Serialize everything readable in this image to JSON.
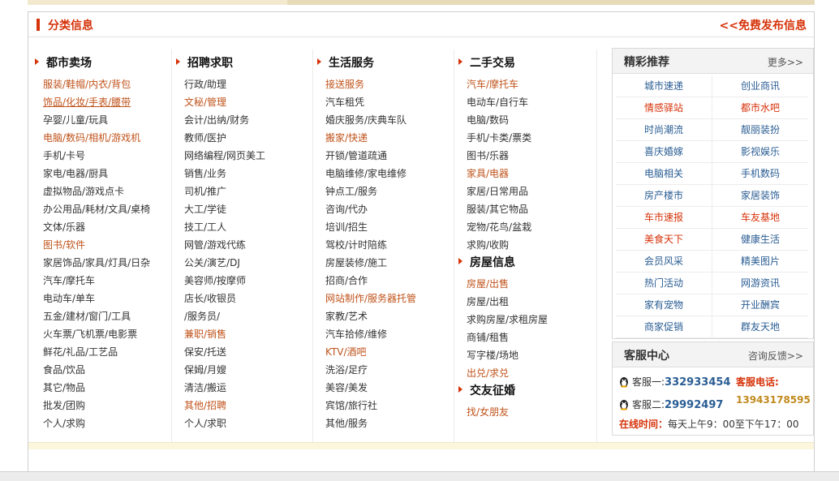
{
  "header": {
    "title": "分类信息",
    "post_link": "<<免费发布信息"
  },
  "columns": [
    {
      "sections": [
        {
          "name": "都市卖场",
          "items": [
            {
              "t": "服装/鞋帽/内衣/背包",
              "hot": true
            },
            {
              "t": "饰品/化妆/手表/腰带",
              "hot": true,
              "ul": true
            },
            {
              "t": "孕婴/儿童/玩具"
            },
            {
              "t": "电脑/数码/相机/游戏机",
              "hot": true
            },
            {
              "t": "手机/卡号"
            },
            {
              "t": "家电/电器/厨具"
            },
            {
              "t": "虚拟物品/游戏点卡"
            },
            {
              "t": "办公用品/耗材/文具/桌椅"
            },
            {
              "t": "文体/乐器"
            },
            {
              "t": "图书/软件",
              "hot": true
            },
            {
              "t": "家居饰品/家具/灯具/日杂"
            },
            {
              "t": "汽车/摩托车"
            },
            {
              "t": "电动车/单车"
            },
            {
              "t": "五金/建材/窗门/工具"
            },
            {
              "t": "火车票/飞机票/电影票"
            },
            {
              "t": "鲜花/礼品/工艺品"
            },
            {
              "t": "食品/饮品"
            },
            {
              "t": "其它/物品"
            },
            {
              "t": "批发/团购"
            },
            {
              "t": "个人/求购"
            }
          ]
        }
      ]
    },
    {
      "sections": [
        {
          "name": "招聘求职",
          "items": [
            {
              "t": "行政/助理"
            },
            {
              "t": "文秘/管理",
              "hot": true
            },
            {
              "t": "会计/出纳/财务"
            },
            {
              "t": "教师/医护"
            },
            {
              "t": "网络编程/网页美工"
            },
            {
              "t": "销售/业务"
            },
            {
              "t": "司机/推广"
            },
            {
              "t": "大工/学徒"
            },
            {
              "t": "技工/工人"
            },
            {
              "t": "网管/游戏代练"
            },
            {
              "t": "公关/演艺/DJ"
            },
            {
              "t": "美容师/按摩师"
            },
            {
              "t": "店长/收银员"
            },
            {
              "t": "/服务员/"
            },
            {
              "t": "兼职/销售",
              "hot": true
            },
            {
              "t": "保安/托送"
            },
            {
              "t": "保姆/月嫂"
            },
            {
              "t": "清洁/搬运"
            },
            {
              "t": "其他/招聘",
              "hot": true
            },
            {
              "t": "个人/求职"
            }
          ]
        }
      ]
    },
    {
      "sections": [
        {
          "name": "生活服务",
          "items": [
            {
              "t": "接送服务",
              "hot": true
            },
            {
              "t": "汽车租凭"
            },
            {
              "t": "婚庆服务/庆典车队"
            },
            {
              "t": "搬家/快递",
              "hot": true
            },
            {
              "t": "开锁/管道疏通"
            },
            {
              "t": "电脑维修/家电维修"
            },
            {
              "t": "钟点工/服务"
            },
            {
              "t": "咨询/代办"
            },
            {
              "t": "培训/招生"
            },
            {
              "t": "驾校/计时陪练"
            },
            {
              "t": "房屋装修/施工"
            },
            {
              "t": "招商/合作"
            },
            {
              "t": "网站制作/服务器托管",
              "hot": true
            },
            {
              "t": "家教/艺术"
            },
            {
              "t": "汽车拾修/维修"
            },
            {
              "t": "KTV/酒吧",
              "hot": true
            },
            {
              "t": "洗浴/足疗"
            },
            {
              "t": "美容/美发"
            },
            {
              "t": "宾馆/旅行社"
            },
            {
              "t": "其他/服务"
            }
          ]
        }
      ]
    },
    {
      "sections": [
        {
          "name": "二手交易",
          "items": [
            {
              "t": "汽车/摩托车",
              "hot": true
            },
            {
              "t": "电动车/自行车"
            },
            {
              "t": "电脑/数码"
            },
            {
              "t": "手机/卡类/票类"
            },
            {
              "t": "图书/乐器"
            },
            {
              "t": "家具/电器",
              "hot": true
            },
            {
              "t": "家居/日常用品"
            },
            {
              "t": "服装/其它物品"
            },
            {
              "t": "宠物/花鸟/盆栽"
            },
            {
              "t": "求购/收购"
            }
          ]
        },
        {
          "name": "房屋信息",
          "items": [
            {
              "t": "房屋/出售",
              "hot": true
            },
            {
              "t": "房屋/出租"
            },
            {
              "t": "求购房屋/求租房屋"
            },
            {
              "t": "商铺/租售"
            },
            {
              "t": "写字楼/场地"
            },
            {
              "t": "出兑/求兑",
              "hot": true
            }
          ]
        },
        {
          "name": "交友征婚",
          "items": [
            {
              "t": "找/女朋友",
              "hot": true
            }
          ]
        }
      ]
    }
  ],
  "featured": {
    "title": "精彩推荐",
    "more": "更多>>",
    "links": [
      {
        "t": "城市速递"
      },
      {
        "t": "创业商讯"
      },
      {
        "t": "情感驿站",
        "hot": true
      },
      {
        "t": "都市水吧",
        "hot": true
      },
      {
        "t": "时尚潮流"
      },
      {
        "t": "靓丽装扮"
      },
      {
        "t": "喜庆婚嫁"
      },
      {
        "t": "影视娱乐"
      },
      {
        "t": "电脑相关"
      },
      {
        "t": "手机数码"
      },
      {
        "t": "房产楼市"
      },
      {
        "t": "家居装饰"
      },
      {
        "t": "车市速报",
        "hot": true
      },
      {
        "t": "车友基地",
        "hot": true
      },
      {
        "t": "美食天下",
        "hot": true
      },
      {
        "t": "健康生活"
      },
      {
        "t": "会员风采"
      },
      {
        "t": "精美图片"
      },
      {
        "t": "热门活动"
      },
      {
        "t": "网游资讯"
      },
      {
        "t": "家有宠物"
      },
      {
        "t": "开业酬宾"
      },
      {
        "t": "商家促销"
      },
      {
        "t": "群友天地"
      }
    ]
  },
  "service": {
    "title": "客服中心",
    "feedback": "咨询反馈>>",
    "kf1_label": "客服一:",
    "kf1_num": "332933454",
    "kf2_label": "客服二:",
    "kf2_num": "29992497",
    "tel_label": "客服电话:",
    "tel_num": "13943178595",
    "online_label": "在线时间：",
    "online_value": "每天上午9：00至下午17：00"
  },
  "colors": {
    "accent": "#d6330a",
    "link_hot": "#c0531b",
    "link_blue": "#2a5d93"
  }
}
